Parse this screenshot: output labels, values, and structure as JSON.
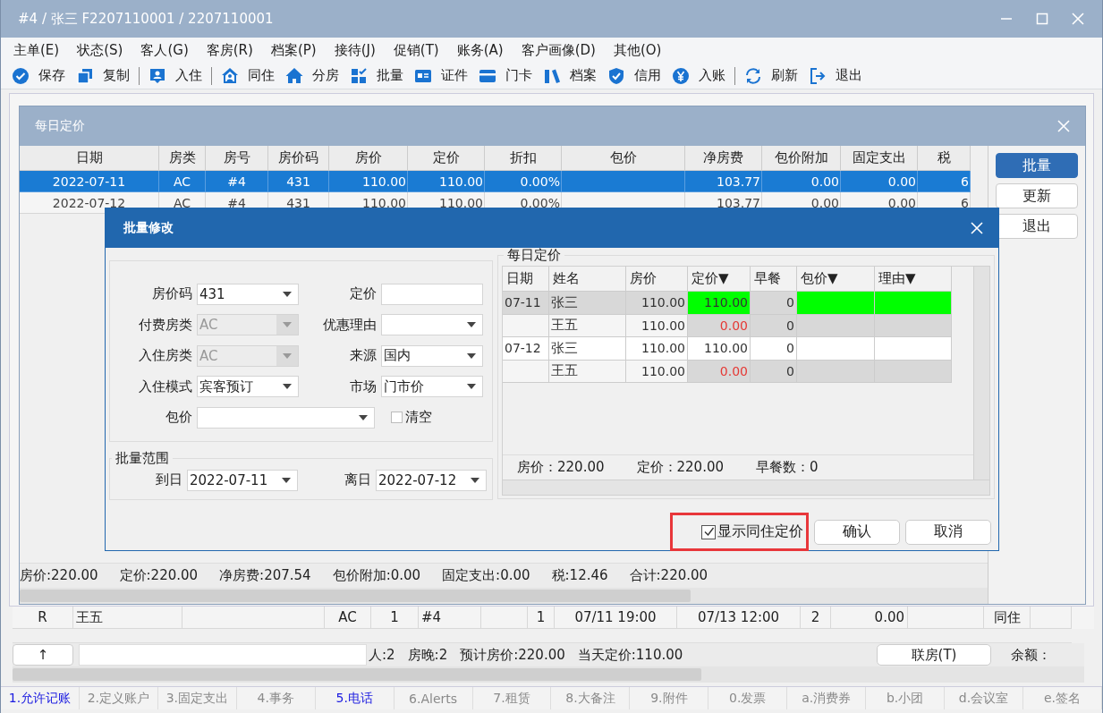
{
  "window": {
    "title": "#4 / 张三 F2207110001 / 2207110001"
  },
  "menu": [
    "主单(E)",
    "状态(S)",
    "客人(G)",
    "客房(R)",
    "档案(P)",
    "接待(J)",
    "促销(T)",
    "账务(A)",
    "客户画像(D)",
    "其他(O)"
  ],
  "toolbar": [
    {
      "label": "保存",
      "divider_after": false
    },
    {
      "label": "复制",
      "divider_after": true
    },
    {
      "label": "入住",
      "divider_after": true
    },
    {
      "label": "同住",
      "divider_after": false
    },
    {
      "label": "分房",
      "divider_after": false
    },
    {
      "label": "批量",
      "divider_after": false
    },
    {
      "label": "证件",
      "divider_after": false
    },
    {
      "label": "门卡",
      "divider_after": false
    },
    {
      "label": "档案",
      "divider_after": false
    },
    {
      "label": "信用",
      "divider_after": false
    },
    {
      "label": "入账",
      "divider_after": true
    },
    {
      "label": "刷新",
      "divider_after": false
    },
    {
      "label": "退出",
      "divider_after": false
    }
  ],
  "guest_table": {
    "rows": [
      {
        "column_1": "R",
        "column_2": "王五",
        "column_4": "AC",
        "column_5": "1",
        "column_6": "#4",
        "column_8": "1",
        "column_9": "07/11 19:00",
        "column_10": "07/13 12:00",
        "column_11": "2",
        "column_12": "0.00",
        "column_14": "同住"
      }
    ]
  },
  "status_bar": {
    "up_button": "↑",
    "stats": [
      "人:2",
      "房晚:2",
      "预计房价:220.00",
      "当天定价:110.00"
    ],
    "link_button": "联房(T)",
    "balance_label": "余额："
  },
  "tabs": [
    {
      "label": "1.允许记账",
      "active": true
    },
    {
      "label": "2.定义账户",
      "active": false
    },
    {
      "label": "3.固定支出",
      "active": false
    },
    {
      "label": "4.事务",
      "active": false
    },
    {
      "label": "5.电话",
      "active": true
    },
    {
      "label": "6.Alerts",
      "active": false
    },
    {
      "label": "7.租赁",
      "active": false
    },
    {
      "label": "8.大备注",
      "active": false
    },
    {
      "label": "9.附件",
      "active": false
    },
    {
      "label": "0.发票",
      "active": false
    },
    {
      "label": "a.消费券",
      "active": false
    },
    {
      "label": "b.小团",
      "active": false
    },
    {
      "label": "d.会议室",
      "active": false
    },
    {
      "label": "e.签名",
      "active": false
    }
  ],
  "daily_rates_dialog": {
    "title": "每日定价",
    "table": {
      "columns": [
        "日期",
        "房类",
        "房号",
        "房价码",
        "房价",
        "定价",
        "折扣",
        "包价",
        "净房费",
        "包价附加",
        "固定支出",
        "税"
      ],
      "rows": [
        {
          "selected": true,
          "date": "2022-07-11",
          "room_type": "AC",
          "room_no": "#4",
          "rate_code": "431",
          "room_rate": "110.00",
          "set_price": "110.00",
          "discount": "0.00%",
          "net_room_fee": "103.77",
          "package_addon": "0.00",
          "fixed_expense": "0.00",
          "tax": "6"
        },
        {
          "selected": false,
          "date": "2022-07-12",
          "room_type": "AC",
          "room_no": "#4",
          "rate_code": "431",
          "room_rate": "110.00",
          "set_price": "110.00",
          "discount": "0.00%",
          "net_room_fee": "103.77",
          "package_addon": "0.00",
          "fixed_expense": "0.00",
          "tax": "6"
        }
      ]
    },
    "totals": [
      "房价:220.00",
      "定价:220.00",
      "净房费:207.54",
      "包价附加:0.00",
      "固定支出:0.00",
      "税:12.46",
      "合计:220.00"
    ],
    "side_buttons": [
      {
        "label": "批量",
        "selected": true
      },
      {
        "label": "更新",
        "selected": false
      },
      {
        "label": "退出",
        "selected": false
      }
    ]
  },
  "batch_dialog": {
    "title": "批量修改",
    "form": {
      "rows": [
        {
          "fields": [
            {
              "label": "房价码",
              "kind": "combo",
              "value": "431",
              "disabled": false
            },
            {
              "label": "定价",
              "kind": "text",
              "disabled": false
            }
          ]
        },
        {
          "fields": [
            {
              "label": "付费房类",
              "kind": "combo",
              "value": "AC",
              "disabled": true
            },
            {
              "label": "优惠理由",
              "kind": "combo",
              "disabled": false
            }
          ]
        },
        {
          "fields": [
            {
              "label": "入住房类",
              "kind": "combo",
              "value": "AC",
              "disabled": true
            },
            {
              "label": "来源",
              "kind": "combo",
              "value": "国内",
              "disabled": false
            }
          ]
        },
        {
          "fields": [
            {
              "label": "入住模式",
              "kind": "combo",
              "value": "宾客预订",
              "disabled": false
            },
            {
              "label": "市场",
              "kind": "combo",
              "value": "门市价",
              "disabled": false
            }
          ]
        },
        {
          "fields": [
            {
              "label": "包价",
              "kind": "combo",
              "disabled": false
            },
            {
              "label": "清空",
              "kind": "checkbox",
              "checked": false
            }
          ]
        }
      ]
    },
    "range": {
      "title": "批量范围",
      "fields": [
        {
          "label": "到日",
          "kind": "combo",
          "value": "2022-07-11",
          "disabled": false
        },
        {
          "label": "离日",
          "kind": "combo",
          "value": "2022-07-12",
          "disabled": false
        }
      ]
    },
    "daily": {
      "title": "每日定价",
      "columns": [
        "日期",
        "姓名",
        "房价",
        "定价▼",
        "早餐",
        "包价▼",
        "理由▼"
      ],
      "rows": [
        {
          "kind": "main",
          "selected": true,
          "date": "07-11",
          "name": "张三",
          "room_rate": "110.00",
          "set_price": "110.00",
          "breakfast": "0"
        },
        {
          "kind": "sharer",
          "selected": false,
          "name": "王五",
          "room_rate": "110.00",
          "set_price": "0.00",
          "breakfast": "0"
        },
        {
          "kind": "main",
          "selected": false,
          "date": "07-12",
          "name": "张三",
          "room_rate": "110.00",
          "set_price": "110.00",
          "breakfast": "0"
        },
        {
          "kind": "sharer",
          "selected": false,
          "name": "王五",
          "room_rate": "110.00",
          "set_price": "0.00",
          "breakfast": "0"
        }
      ],
      "summary": [
        "房价：220.00",
        "定价：220.00",
        "早餐数：0"
      ]
    },
    "show_sharer_checkbox": {
      "label": "显示同住定价",
      "checked": true,
      "highlighted": true
    },
    "buttons": [
      "确认",
      "取消"
    ]
  }
}
